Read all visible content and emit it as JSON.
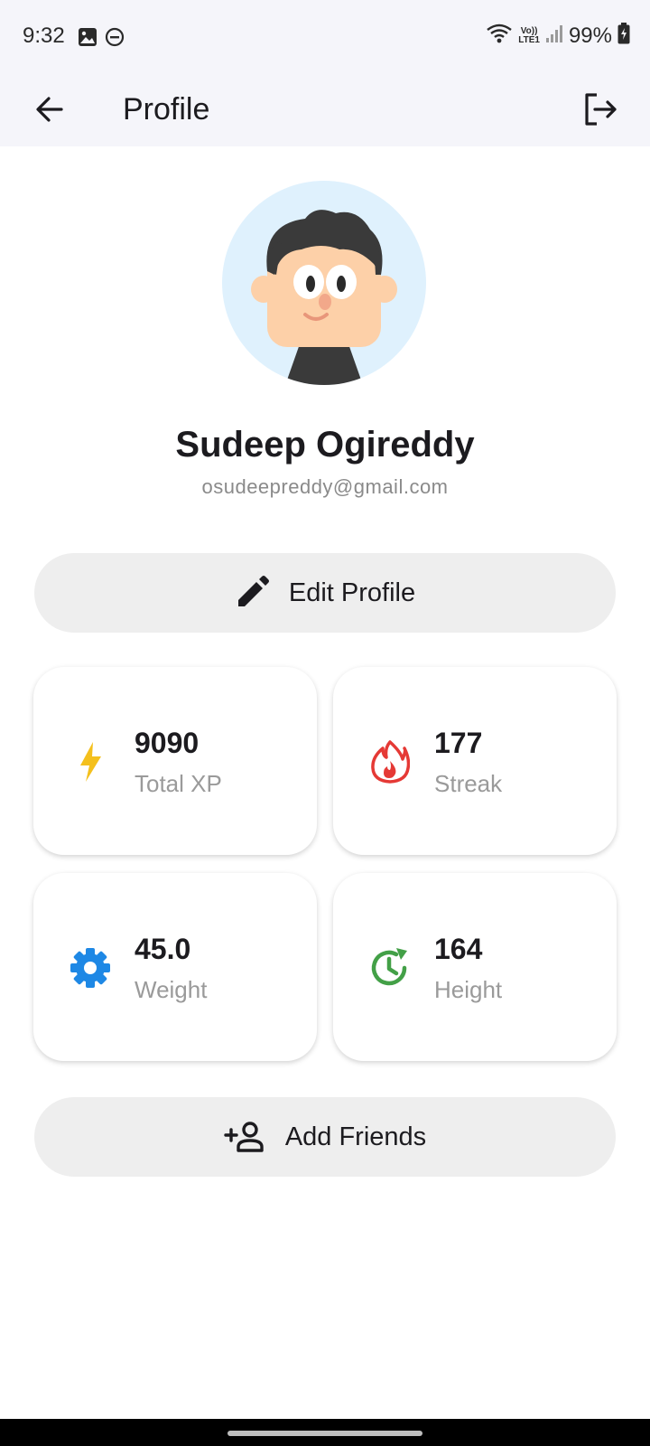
{
  "status_bar": {
    "time": "9:32",
    "battery": "99%",
    "network": "LTE1",
    "icons": [
      "image-icon",
      "dnd-icon",
      "wifi-icon",
      "volte-icon",
      "signal-icon",
      "battery-charging-icon"
    ]
  },
  "app_bar": {
    "title": "Profile",
    "back_icon": "arrow-left-icon",
    "logout_icon": "logout-icon"
  },
  "profile": {
    "name": "Sudeep Ogireddy",
    "email": "osudeepreddy@gmail.com",
    "avatar_bg": "#dff1fd"
  },
  "edit_button": {
    "label": "Edit Profile",
    "icon": "pencil-icon"
  },
  "stats": [
    {
      "value": "9090",
      "label": "Total XP",
      "icon": "lightning-icon",
      "color": "#f4c01d"
    },
    {
      "value": "177",
      "label": "Streak",
      "icon": "flame-icon",
      "color": "#e53935"
    },
    {
      "value": "45.0",
      "label": "Weight",
      "icon": "gear-icon",
      "color": "#1e88e5"
    },
    {
      "value": "164",
      "label": "Height",
      "icon": "clock-refresh-icon",
      "color": "#43a047"
    }
  ],
  "friends_button": {
    "label": "Add Friends",
    "icon": "add-person-icon"
  }
}
